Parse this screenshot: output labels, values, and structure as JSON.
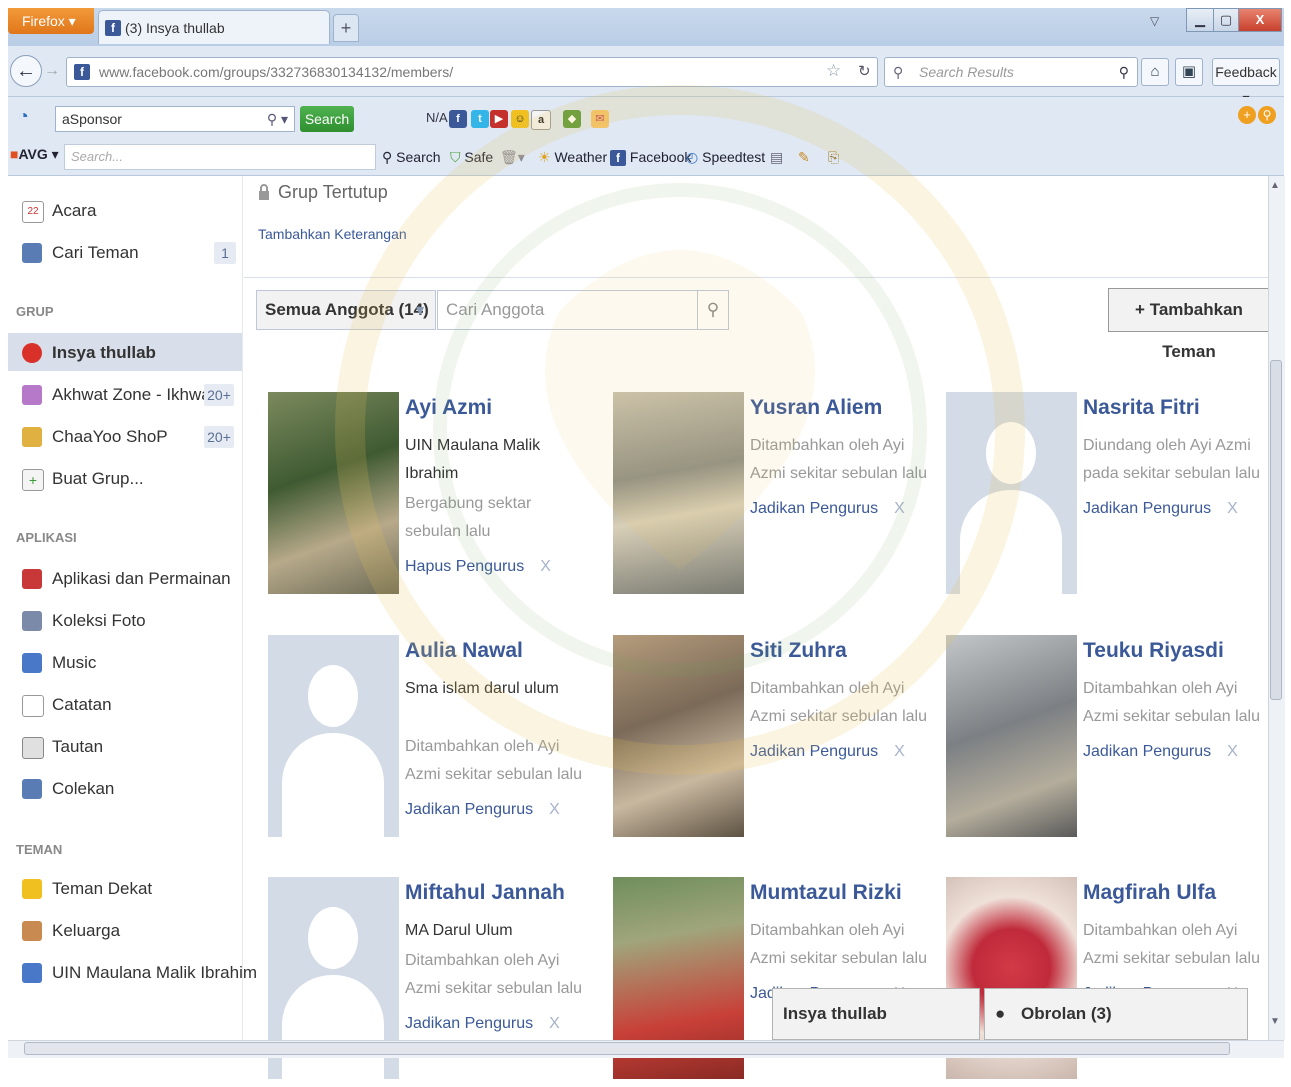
{
  "browser": {
    "app_button": "Firefox",
    "tab_title": "(3) Insya thullab",
    "url": "www.facebook.com/groups/332736830134132/members/",
    "search_placeholder": "Search Results",
    "feedback_label": "Feedback"
  },
  "toolbar": {
    "asponsor_value": "aSponsor",
    "search_button": "Search",
    "na_label": "N/A",
    "avg_label": "AVG",
    "avg_search_placeholder": "Search...",
    "items": [
      "Search",
      "Safe",
      "Weather",
      "Facebook",
      "Speedtest"
    ]
  },
  "sidebar": {
    "top_items": [
      {
        "label": "Acara"
      },
      {
        "label": "Cari Teman",
        "count": "1"
      }
    ],
    "group_heading": "GRUP",
    "groups": [
      {
        "label": "Insya thullab"
      },
      {
        "label": "Akhwat Zone - Ikhwa...",
        "count": "20+"
      },
      {
        "label": "ChaaYoo ShoP",
        "count": "20+"
      },
      {
        "label": "Buat Grup..."
      }
    ],
    "apps_heading": "APLIKASI",
    "apps": [
      {
        "label": "Aplikasi dan Permainan"
      },
      {
        "label": "Koleksi Foto"
      },
      {
        "label": "Music"
      },
      {
        "label": "Catatan"
      },
      {
        "label": "Tautan"
      },
      {
        "label": "Colekan"
      }
    ],
    "friends_heading": "TEMAN",
    "friends": [
      {
        "label": "Teman Dekat"
      },
      {
        "label": "Keluarga"
      },
      {
        "label": "UIN Maulana Malik Ibrahim"
      }
    ]
  },
  "main": {
    "group_type": "Grup Tertutup",
    "add_description": "Tambahkan Keterangan",
    "members_dropdown": "Semua Anggota (14)",
    "member_search_placeholder": "Cari Anggota",
    "add_friend_button": "Tambahkan Teman",
    "members": [
      {
        "name": "Ayi Azmi",
        "line1": "UIN Maulana Malik Ibrahim",
        "line2": "Bergabung sektar sebulan lalu",
        "action": "Hapus Pengurus",
        "photo": "outdoor"
      },
      {
        "name": "Yusran Aliem",
        "line1": "",
        "line2": "Ditambahkan oleh Ayi Azmi sekitar sebulan lalu",
        "action": "Jadikan Pengurus",
        "photo": "building"
      },
      {
        "name": "Nasrita Fitri",
        "line1": "",
        "line2": "Diundang oleh Ayi Azmi pada sekitar sebulan lalu",
        "action": "Jadikan Pengurus",
        "photo": "silhouette"
      },
      {
        "name": "Aulia Nawal",
        "line1": "Sma islam darul ulum",
        "line2": "Ditambahkan oleh Ayi Azmi sekitar sebulan lalu",
        "action": "Jadikan Pengurus",
        "photo": "silhouette"
      },
      {
        "name": "Siti Zuhra",
        "line1": "",
        "line2": "Ditambahkan oleh Ayi Azmi sekitar sebulan lalu",
        "action": "Jadikan Pengurus",
        "photo": "classroom"
      },
      {
        "name": "Teuku Riyasdi",
        "line1": "",
        "line2": "Ditambahkan oleh Ayi Azmi sekitar sebulan lalu",
        "action": "Jadikan Pengurus",
        "photo": "lab"
      },
      {
        "name": "Miftahul Jannah",
        "line1": "MA Darul Ulum",
        "line2": "Ditambahkan oleh Ayi Azmi sekitar sebulan lalu",
        "action": "Jadikan Pengurus",
        "photo": "silhouette"
      },
      {
        "name": "Mumtazul Rizki",
        "line1": "",
        "line2": "Ditambahkan oleh Ayi Azmi sekitar sebulan lalu",
        "action": "Jadikan Pengurus",
        "photo": "crowd"
      },
      {
        "name": "Magfirah Ulfa",
        "line1": "",
        "line2": "Ditambahkan oleh Ayi Azmi sekitar sebulan lalu",
        "action": "Jadikan Pengurus",
        "photo": "cake"
      }
    ],
    "remove_glyph": "X"
  },
  "chat": {
    "window_title": "Insya thullab",
    "chat_label": "Obrolan (3)"
  },
  "colors": {
    "facebook_blue": "#3b5998",
    "chrome_blue": "#dfe8f3",
    "firefox_orange": "#e0761a"
  }
}
